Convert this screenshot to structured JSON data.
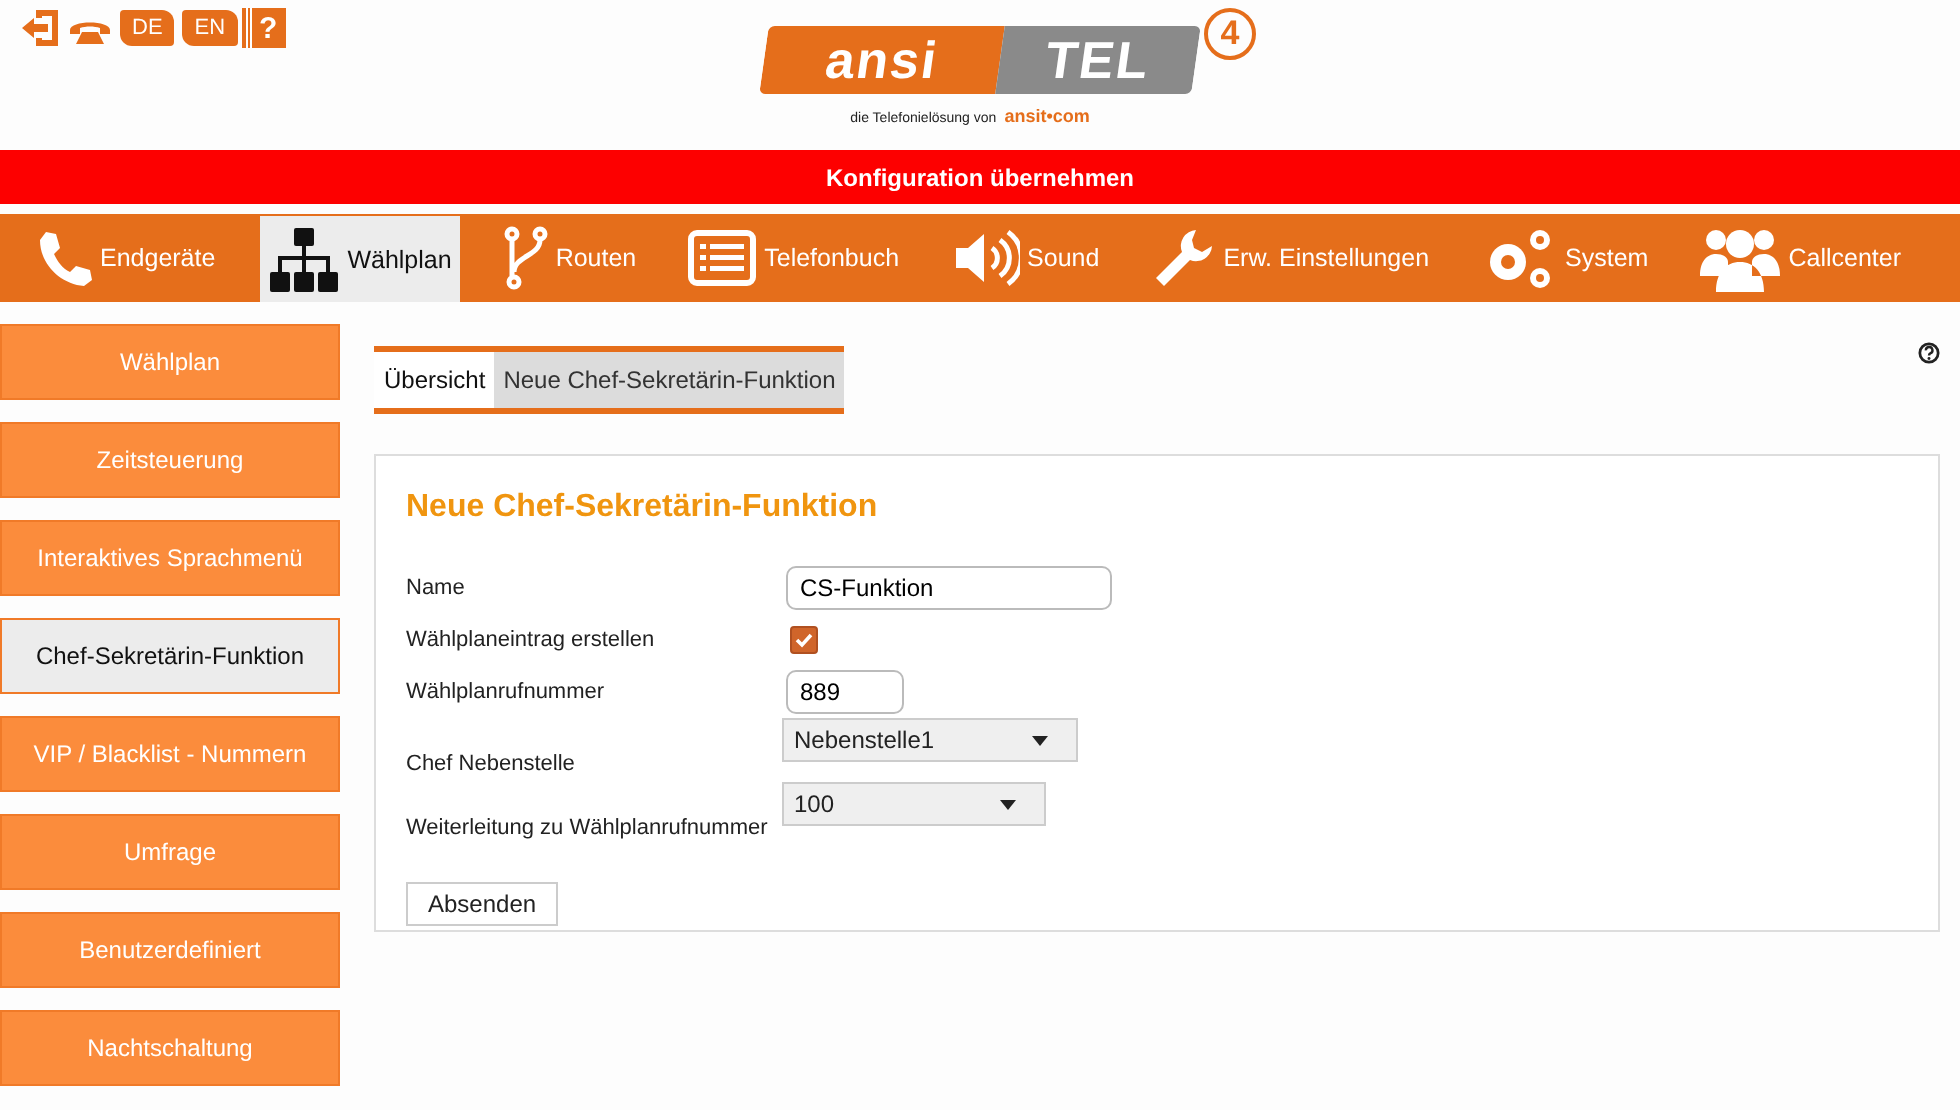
{
  "top_links": [
    {
      "kind": "exit"
    },
    {
      "kind": "hangup"
    },
    {
      "kind": "flag",
      "label": "DE"
    },
    {
      "kind": "flag",
      "label": "EN"
    },
    {
      "kind": "help",
      "label": "?"
    }
  ],
  "logo": {
    "left": "ansi",
    "right": "TEL",
    "version": "4",
    "tagline": "die Telefonielösung von",
    "brand": "ansit•com"
  },
  "apply_bar": "Konfiguration übernehmen",
  "nav": [
    {
      "label": "Endgeräte",
      "selected": false
    },
    {
      "label": "Wählplan",
      "selected": true
    },
    {
      "label": "Routen",
      "selected": false
    },
    {
      "label": "Telefonbuch",
      "selected": false
    },
    {
      "label": "Sound",
      "selected": false
    },
    {
      "label": "Erw. Einstellungen",
      "selected": false
    },
    {
      "label": "System",
      "selected": false
    },
    {
      "label": "Callcenter",
      "selected": false
    }
  ],
  "sidebar": {
    "items": [
      {
        "label": "Wählplan",
        "selected": false
      },
      {
        "label": "Zeitsteuerung",
        "selected": false
      },
      {
        "label": "Interaktives Sprachmenü",
        "selected": false
      },
      {
        "label": "Chef-Sekretärin-Funktion",
        "selected": true
      },
      {
        "label": "VIP / Blacklist - Nummern",
        "selected": false
      },
      {
        "label": "Umfrage",
        "selected": false
      },
      {
        "label": "Benutzerdefiniert",
        "selected": false
      },
      {
        "label": "Nachtschaltung",
        "selected": false
      }
    ]
  },
  "tabs": [
    {
      "label": "Übersicht",
      "selected": false
    },
    {
      "label": "Neue Chef-Sekretärin-Funktion",
      "selected": true
    }
  ],
  "form": {
    "title": "Neue Chef-Sekretärin-Funktion",
    "fields": [
      {
        "kind": "text",
        "label": "Name",
        "value": "CS-Funktion",
        "wide": true
      },
      {
        "kind": "checkbox",
        "label": "Wählplaneintrag erstellen",
        "checked": true
      },
      {
        "kind": "text",
        "label": "Wählplanrufnummer",
        "value": "889",
        "wide": false
      },
      {
        "kind": "select",
        "label": "Chef Nebenstelle",
        "value": "Nebenstelle1",
        "wide": true
      },
      {
        "kind": "select",
        "label": "Weiterleitung zu Wählplanrufnummer",
        "value": "100",
        "wide": false
      }
    ],
    "submit": "Absenden"
  }
}
